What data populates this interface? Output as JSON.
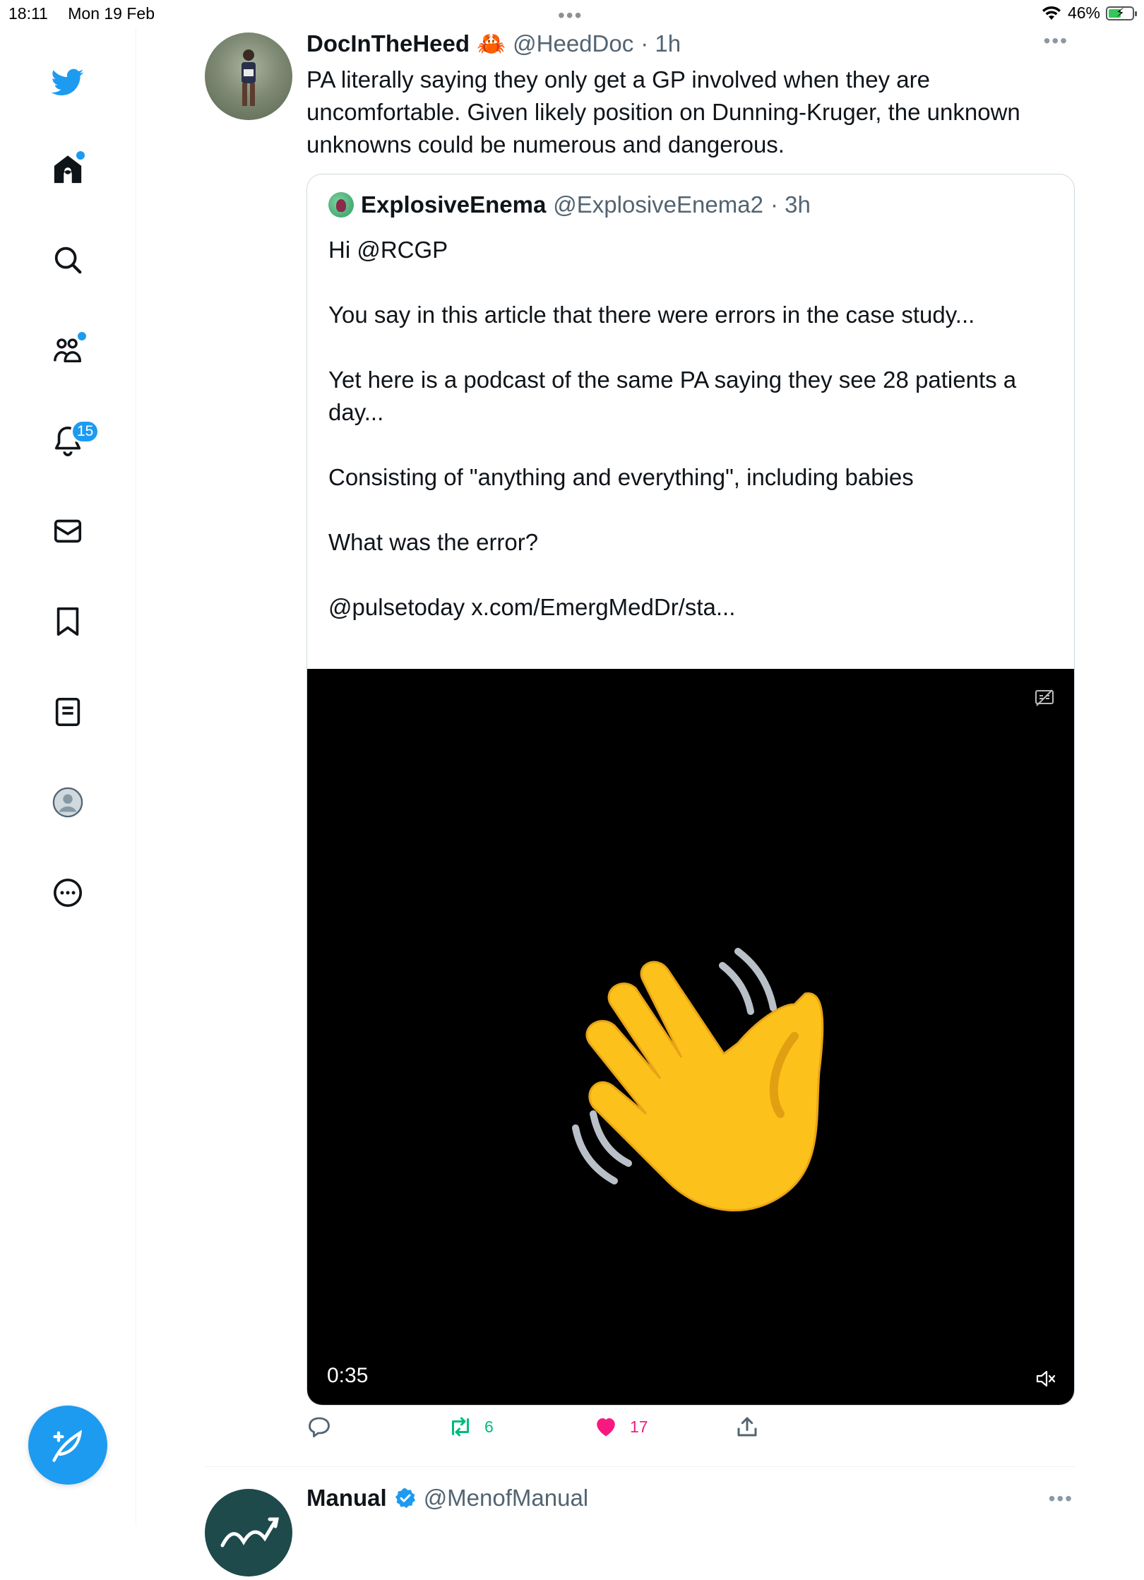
{
  "status_bar": {
    "time": "18:11",
    "date": "Mon 19 Feb",
    "battery": "46%",
    "battery_level": 0.46
  },
  "sidebar": {
    "items": [
      {
        "name": "twitter-logo",
        "icon": "bird-icon"
      },
      {
        "name": "home",
        "icon": "home-icon",
        "dot": true
      },
      {
        "name": "explore",
        "icon": "search-icon"
      },
      {
        "name": "communities",
        "icon": "communities-icon",
        "dot": true
      },
      {
        "name": "notifications",
        "icon": "bell-icon",
        "badge": "15"
      },
      {
        "name": "messages",
        "icon": "envelope-icon"
      },
      {
        "name": "bookmarks",
        "icon": "bookmark-icon"
      },
      {
        "name": "lists",
        "icon": "list-icon"
      },
      {
        "name": "profile",
        "icon": "avatar-icon"
      },
      {
        "name": "more",
        "icon": "more-circle-icon"
      }
    ],
    "notifications_badge": "15",
    "compose_icon": "compose-feather-icon"
  },
  "tweet": {
    "display_name": "DocInTheHeed",
    "emoji": "🦀",
    "handle": "@HeedDoc",
    "time": "· 1h",
    "text": "PA literally saying they only get a GP involved when they are uncomfortable. Given likely position on Dunning-Kruger, the unknown unknowns could be numerous and dangerous.",
    "quote": {
      "display_name": "ExplosiveEnema",
      "handle": "@ExplosiveEnema2",
      "time": "· 3h",
      "lines": [
        "Hi @RCGP",
        "You say in this article that there were errors in the case study...",
        "Yet here is a podcast of the same PA saying they see 28 patients a day...",
        "Consisting of \"anything and everything\", including babies",
        "What was the error?",
        "@pulsetoday x.com/EmergMedDr/sta..."
      ],
      "video_duration": "0:35"
    },
    "actions": {
      "reply_count": "",
      "retweet_count": "6",
      "like_count": "17"
    },
    "colors": {
      "retweet": "#00ba7c",
      "like": "#f91880",
      "accent": "#1d9bf0"
    }
  },
  "next_tweet": {
    "display_name": "Manual",
    "handle": "@MenofManual"
  }
}
